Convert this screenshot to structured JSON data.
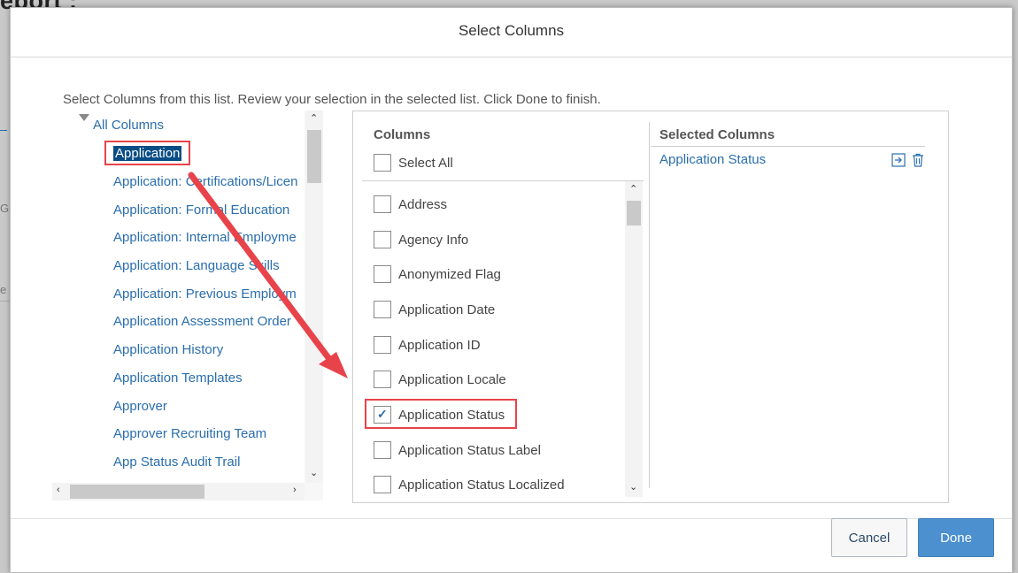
{
  "background": {
    "title_fragment": "eport :",
    "frag_g": "G",
    "frag_e": "e"
  },
  "dialog": {
    "title": "Select Columns",
    "instructions": "Select Columns from this list. Review your selection in the selected list. Click Done to finish."
  },
  "tree": {
    "root_label": "All Columns",
    "items": [
      "Application",
      "Application: Certifications/Licen",
      "Application: Formal Education",
      "Application: Internal Employme",
      "Application: Language Skills",
      "Application: Previous Employm",
      "Application Assessment Order",
      "Application History",
      "Application Templates",
      "Approver",
      "Approver Recruiting Team",
      "App Status Audit Trail"
    ],
    "selected_item": "Application"
  },
  "columns_panel": {
    "heading": "Columns",
    "select_all_label": "Select All",
    "items": [
      {
        "label": "Address",
        "checked": false
      },
      {
        "label": "Agency Info",
        "checked": false
      },
      {
        "label": "Anonymized Flag",
        "checked": false
      },
      {
        "label": "Application Date",
        "checked": false
      },
      {
        "label": "Application ID",
        "checked": false
      },
      {
        "label": "Application Locale",
        "checked": false
      },
      {
        "label": "Application Status",
        "checked": true
      },
      {
        "label": "Application Status Label",
        "checked": false
      },
      {
        "label": "Application Status Localized",
        "checked": false
      }
    ]
  },
  "selected_panel": {
    "heading": "Selected Columns",
    "items": [
      "Application Status"
    ],
    "icons": [
      "move-icon",
      "trash-icon"
    ]
  },
  "footer": {
    "cancel_label": "Cancel",
    "done_label": "Done"
  },
  "colors": {
    "link": "#2a6ead",
    "highlight": "#e8434a",
    "done_button": "#4c90cf",
    "selected_node": "#0a4d85"
  }
}
